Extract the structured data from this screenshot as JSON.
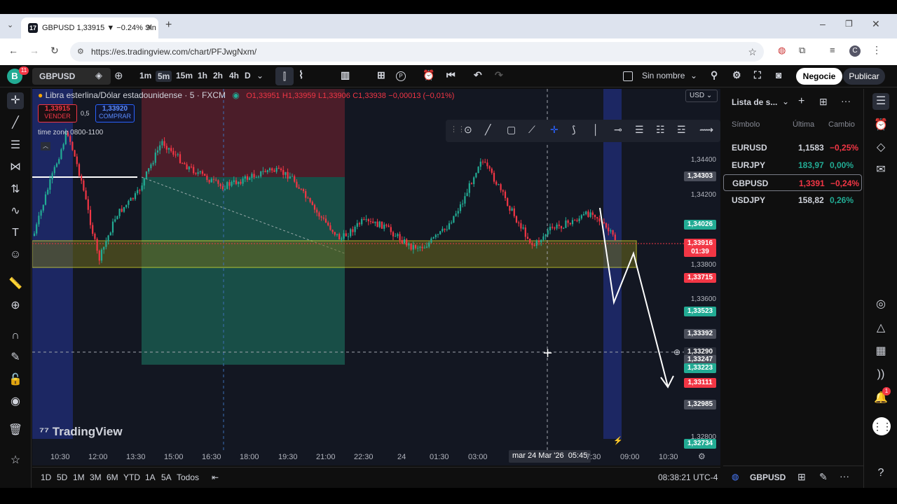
{
  "browser": {
    "tab_title": "GBPUSD 1,33915 ▼ −0.24% Sin",
    "url": "https://es.tradingview.com/chart/PFJwgNxm/"
  },
  "toolbar": {
    "avatar_letter": "B",
    "avatar_badge": "11",
    "symbol": "GBPUSD",
    "intervals": [
      "1m",
      "5m",
      "15m",
      "1h",
      "2h",
      "4h",
      "D"
    ],
    "layout_name": "Sin nombre",
    "trade_button": "Negocie",
    "publish_button": "Publicar"
  },
  "chart": {
    "legend_title": "Libra esterlina/Dólar estadounidense · 5 · FXCM",
    "ohlc": {
      "o": "O1,33951",
      "h": "H1,33959",
      "l": "L1,33906",
      "c": "C1,33938",
      "chg": "−0,00013 (−0,01%)"
    },
    "sell_price": "1,33915",
    "sell_label": "VENDER",
    "spread": "0,5",
    "buy_price": "1,33920",
    "buy_label": "COMPRAR",
    "session_label": "time zone 0800-1100",
    "currency": "USD",
    "price_axis": [
      "1,34400",
      "1,34200",
      "1,33800",
      "1,33600",
      "1,32800"
    ],
    "price_tags": [
      {
        "label": "1,34303",
        "color": "#4a4e5a"
      },
      {
        "label": "1,34026",
        "color": "#22ab94"
      },
      {
        "label": "1,33916",
        "color": "#f23645"
      },
      {
        "label": "01:39",
        "color": "#f23645"
      },
      {
        "label": "1,33715",
        "color": "#f23645"
      },
      {
        "label": "1,33523",
        "color": "#22ab94"
      },
      {
        "label": "1,33392",
        "color": "#4a4e5a"
      },
      {
        "label": "1,33290",
        "color": "#2a2e39"
      },
      {
        "label": "1,33247",
        "color": "#4a4e5a"
      },
      {
        "label": "1,33223",
        "color": "#22ab94"
      },
      {
        "label": "1,33111",
        "color": "#f23645"
      },
      {
        "label": "1,32985",
        "color": "#4a4e5a"
      },
      {
        "label": "1,32734",
        "color": "#22ab94"
      }
    ],
    "time_axis": [
      "10:30",
      "12:00",
      "13:30",
      "15:00",
      "16:30",
      "18:00",
      "19:30",
      "21:00",
      "22:30",
      "24",
      "01:30",
      "03:00",
      "7:30",
      "09:00",
      "10:30"
    ],
    "crosshair_time": "mar 24 Mar '26",
    "crosshair_time2": "05:45",
    "watermark": "TradingView"
  },
  "bottom": {
    "ranges": [
      "1D",
      "5D",
      "1M",
      "3M",
      "6M",
      "YTD",
      "1A",
      "5A",
      "Todos"
    ],
    "clock": "08:38:21 UTC-4"
  },
  "watchlist": {
    "title": "Lista de s...",
    "col_symbol": "Símbolo",
    "col_last": "Última",
    "col_change": "Cambio",
    "rows": [
      {
        "symbol": "EURUSD",
        "last": "1,1583",
        "change": "−0,25%",
        "up": false
      },
      {
        "symbol": "EURJPY",
        "last": "183,97",
        "change": "0,00%",
        "up": true
      },
      {
        "symbol": "GBPUSD",
        "last": "1,3391",
        "change": "−0,24%",
        "up": false
      },
      {
        "symbol": "USDJPY",
        "last": "158,82",
        "change": "0,26%",
        "up": true
      }
    ],
    "footer_symbol": "GBPUSD"
  },
  "notifications_badge": "1"
}
